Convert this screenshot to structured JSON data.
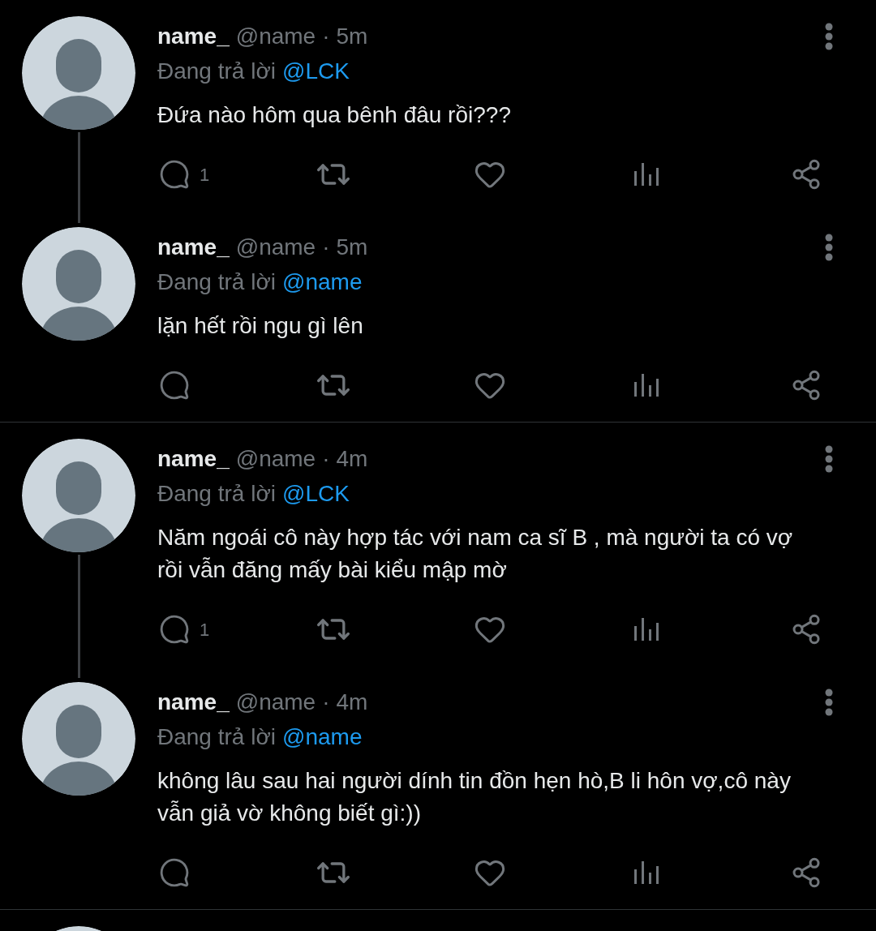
{
  "threads": [
    {
      "tweets": [
        {
          "name": "name_",
          "handle": "@name",
          "separator": "·",
          "time": "5m",
          "reply_label": "Đang trả lời",
          "reply_to": "@LCK",
          "text": "Đứa nào hôm qua bênh đâu rồi???",
          "reply_count": "1"
        },
        {
          "name": "name_",
          "handle": "@name",
          "separator": "·",
          "time": "5m",
          "reply_label": "Đang trả lời",
          "reply_to": "@name",
          "text": "lặn hết rồi ngu gì lên"
        }
      ]
    },
    {
      "tweets": [
        {
          "name": "name_",
          "handle": "@name",
          "separator": "·",
          "time": "4m",
          "reply_label": "Đang trả lời",
          "reply_to": "@LCK",
          "text": "Năm ngoái cô này hợp tác với nam ca sĩ B , mà người ta có vợ rồi vẫn đăng mấy bài kiểu mập mờ",
          "reply_count": "1"
        },
        {
          "name": "name_",
          "handle": "@name",
          "separator": "·",
          "time": "4m",
          "reply_label": "Đang trả lời",
          "reply_to": "@name",
          "text": "không lâu sau hai người dính tin đồn hẹn hò,B li hôn vợ,cô này vẫn giả vờ không biết gì:))"
        }
      ]
    }
  ]
}
